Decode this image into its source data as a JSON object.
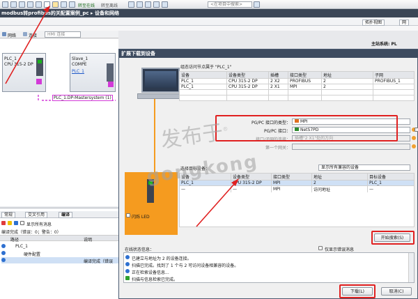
{
  "toolbar": {
    "go_online": "转至在线",
    "go_offline": "转至离线",
    "search_placeholder": "<在项目中搜索>"
  },
  "breadcrumb": {
    "text": "modbus转profibus的关配置案例_pc  ▸  设备和网络"
  },
  "view_tabs": {
    "topology": "拓扑视图",
    "network": "网"
  },
  "main_system": "主站系统: PL",
  "network_toolbar": {
    "network": "网络",
    "connections": "连接",
    "hmi_conn": "HMI 连接"
  },
  "canvas": {
    "plc": {
      "name": "PLC_1",
      "type": "CPU 315-2 DP"
    },
    "slave": {
      "name": "Slave_1",
      "type": "COMPE",
      "link": "PLC_1"
    },
    "master_system": "PLC_1.DP-Mastersystem (1)"
  },
  "lower_tabs": {
    "general": "常规",
    "cross_ref": "交叉引用",
    "compile": "编译"
  },
  "filter": {
    "show_all": "显示所有消息"
  },
  "compile_summary": "编译完成（错误：0；警告：0）",
  "table_cols": {
    "path": "路径",
    "desc": "说明"
  },
  "tree": {
    "plc": "PLC_1",
    "hw": "硬件配置",
    "done": "编译完成（错误"
  },
  "dialog": {
    "title": "扩展下载到设备",
    "config_heading": "组态访问节点属于 \"PLC_1\"",
    "top_cols": [
      "设备",
      "设备类型",
      "插槽",
      "接口类型",
      "地址",
      "子网"
    ],
    "top_rows": [
      [
        "PLC_1",
        "CPU 315-2 DP",
        "2 X2",
        "PROFIBUS",
        "2",
        "PROFIBUS_1"
      ],
      [
        "PLC_1",
        "CPU 315-2 DP",
        "2 X1",
        "MPI",
        "2",
        ""
      ]
    ],
    "pgpc_iface_type_label": "PG/PC 接口的类型：",
    "pgpc_iface_type": "MPI",
    "pgpc_iface_label": "PG/PC 接口：",
    "pgpc_iface": "NetS7PD",
    "subnet_conn_label": "接口/子网的连接：",
    "subnet_conn": "插槽\"2 X1\"处的方向",
    "gateway_label": "第一个网关：",
    "select_target": "选择目标设备：",
    "show_compatible": "显示所有兼容的设备",
    "target_cols": [
      "设备",
      "设备类型",
      "接口类型",
      "地址",
      "目标设备"
    ],
    "target_rows": [
      [
        "PLC_1",
        "CPU 315-2 DP",
        "MPI",
        "2",
        "PLC_1"
      ],
      [
        "—",
        "—",
        "MPI",
        "访问地址",
        "—"
      ]
    ],
    "flash_led": "闪烁 LED",
    "start_search": "开始搜索(S)",
    "online_status": "在线状态信息：",
    "show_errors_only": "仅显示错误消息",
    "messages": [
      "已建立与地址为 2 的设备连接。",
      "扫描已完成。找到了 1 个与 2 可访问设备相兼容的设备。",
      "正在检索设备信息...",
      "扫描与信息检索已完成。"
    ],
    "download": "下载(L)",
    "cancel": "取消(C)"
  },
  "watermark": {
    "text": "发布于",
    "sub": "gongkong",
    "reg": "®"
  },
  "colors": {
    "accent_red": "#e02020",
    "orange": "#f59b1f",
    "title_bar": "#3d4b5f",
    "highlight": "#cfe0f5",
    "dp_line": "#d33ad8"
  }
}
